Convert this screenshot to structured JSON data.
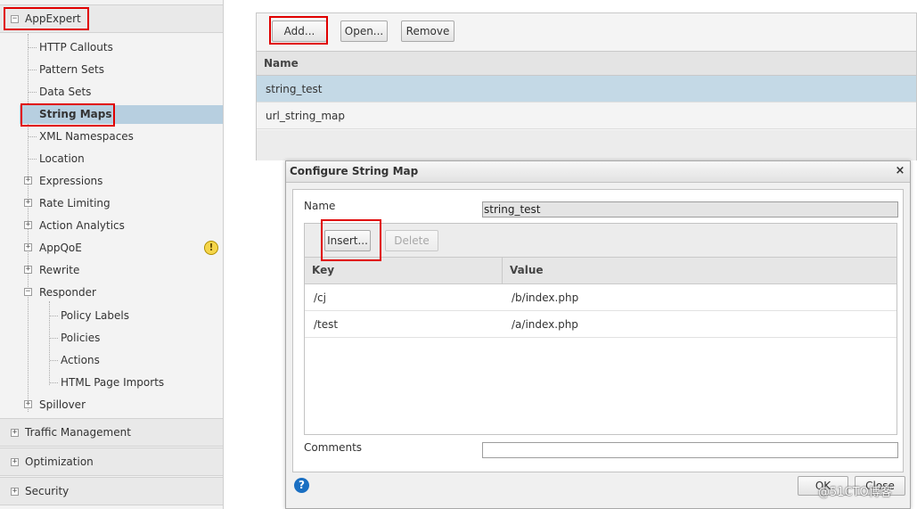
{
  "sidebar": {
    "appexpert_label": "AppExpert",
    "items": [
      {
        "label": "HTTP Callouts"
      },
      {
        "label": "Pattern Sets"
      },
      {
        "label": "Data Sets"
      },
      {
        "label": "String Maps"
      },
      {
        "label": "XML Namespaces"
      },
      {
        "label": "Location"
      },
      {
        "label": "Expressions"
      },
      {
        "label": "Rate Limiting"
      },
      {
        "label": "Action Analytics"
      },
      {
        "label": "AppQoE"
      },
      {
        "label": "Rewrite"
      },
      {
        "label": "Responder"
      },
      {
        "label": "Spillover"
      }
    ],
    "responder_children": [
      {
        "label": "Policy Labels"
      },
      {
        "label": "Policies"
      },
      {
        "label": "Actions"
      },
      {
        "label": "HTML Page Imports"
      }
    ],
    "sections": [
      {
        "label": "Traffic Management"
      },
      {
        "label": "Optimization"
      },
      {
        "label": "Security"
      }
    ],
    "expand_glyph": "+",
    "collapse_glyph": "−",
    "warning_glyph": "!"
  },
  "list": {
    "toolbar": {
      "add_label": "Add...",
      "open_label": "Open...",
      "remove_label": "Remove"
    },
    "header_name": "Name",
    "rows": [
      {
        "name": "string_test"
      },
      {
        "name": "url_string_map"
      }
    ]
  },
  "dialog": {
    "title": "Configure String Map",
    "close_glyph": "×",
    "name_label": "Name",
    "name_value": "string_test",
    "insert_label": "Insert...",
    "delete_label": "Delete",
    "col_key": "Key",
    "col_value": "Value",
    "rows": [
      {
        "key": "/cj",
        "value": "/b/index.php"
      },
      {
        "key": "/test",
        "value": "/a/index.php"
      }
    ],
    "comments_label": "Comments",
    "comments_value": "",
    "ok_label": "OK",
    "close_label": "Close",
    "help_glyph": "?"
  },
  "watermark": "@51CTO博客",
  "colors": {
    "selection": "#c4d9e6",
    "highlight_box": "#e00000",
    "help_icon": "#1a6fc2",
    "warning_icon": "#f5d54a"
  }
}
